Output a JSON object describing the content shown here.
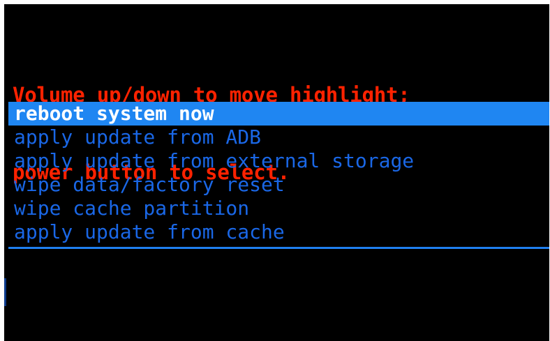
{
  "header": {
    "line1": "Volume up/down to move highlight;",
    "line2": "power button to select."
  },
  "menu": {
    "selected_index": 0,
    "items": [
      {
        "label": "reboot system now"
      },
      {
        "label": "apply update from ADB"
      },
      {
        "label": "apply update from external storage"
      },
      {
        "label": "wipe data/factory reset"
      },
      {
        "label": "wipe cache partition"
      },
      {
        "label": "apply update from cache"
      }
    ]
  },
  "colors": {
    "header_text": "#ff2200",
    "menu_text": "#1a67e6",
    "highlight_bg": "#1f86f2",
    "highlight_text": "#ffffff",
    "background": "#000000"
  }
}
